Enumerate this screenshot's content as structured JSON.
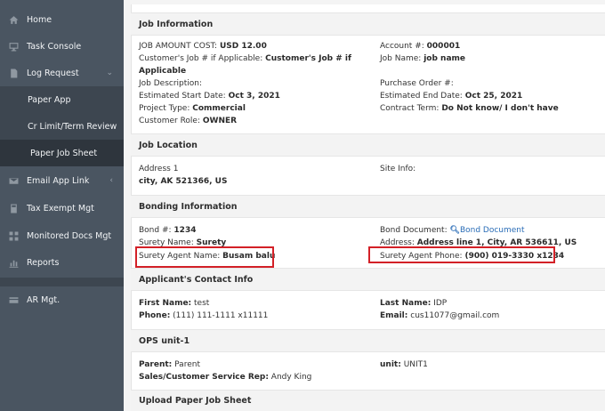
{
  "sidebar": {
    "items": [
      {
        "label": "Home",
        "icon": "home-icon"
      },
      {
        "label": "Task Console",
        "icon": "monitor-icon"
      },
      {
        "label": "Log Request",
        "icon": "file-icon",
        "arrow": "⌄"
      },
      {
        "label": "Paper App"
      },
      {
        "label": "Cr Limit/Term Review"
      },
      {
        "label": "Paper Job Sheet"
      },
      {
        "label": "Email App Link",
        "icon": "envelope-icon",
        "arrow": "‹"
      },
      {
        "label": "Tax Exempt Mgt",
        "icon": "calculator-icon"
      },
      {
        "label": "Monitored Docs Mgt",
        "icon": "grid-icon"
      },
      {
        "label": "Reports",
        "icon": "chart-icon"
      },
      {
        "label": "AR Mgt.",
        "icon": "card-icon"
      }
    ]
  },
  "job_info": {
    "title": "Job Information",
    "amount_label": "JOB AMOUNT COST:",
    "amount_value": "USD 12.00",
    "account_label": "Account #:",
    "account_value": "000001",
    "customer_job_label": "Customer's Job # if Applicable:",
    "customer_job_value_1": "Customer's Job # if",
    "customer_job_value_2": "Applicable",
    "job_name_label": "Job Name:",
    "job_name_value": "job name",
    "description_label": "Job Description:",
    "po_label": "Purchase Order #:",
    "start_label": "Estimated Start Date:",
    "start_value": "Oct 3, 2021",
    "end_label": "Estimated End Date:",
    "end_value": "Oct 25, 2021",
    "project_type_label": "Project Type:",
    "project_type_value": "Commercial",
    "contract_label": "Contract Term:",
    "contract_value": "Do Not know/ I don't have",
    "role_label": "Customer Role:",
    "role_value": "OWNER"
  },
  "job_location": {
    "title": "Job Location",
    "address_line1": "Address 1",
    "address_line2": "city,  AK 521366,  US",
    "site_info_label": "Site Info:"
  },
  "bonding": {
    "title": "Bonding Information",
    "bond_label": "Bond #:",
    "bond_value": "1234",
    "bond_doc_label": "Bond Document:",
    "bond_doc_link": "Bond Document",
    "surety_name_label": "Surety Name:",
    "surety_name_value": "Surety",
    "address_label": "Address:",
    "address_value": "Address line 1, City, AR 536611, US",
    "agent_name_label": "Surety Agent Name:",
    "agent_name_value": "Busam balu",
    "agent_phone_label": "Surety Agent Phone:",
    "agent_phone_value": "(900) 019-3330 x1234"
  },
  "contact": {
    "title": "Applicant's Contact Info",
    "first_label": "First Name:",
    "first_value": "test",
    "last_label": "Last Name:",
    "last_value": "IDP",
    "phone_label": "Phone:",
    "phone_value": "(111) 111-1111 x11111",
    "email_label": "Email:",
    "email_value": "cus11077@gmail.com"
  },
  "ops": {
    "title": "OPS unit-1",
    "parent_label": "Parent:",
    "parent_value": "Parent",
    "unit_label": "unit:",
    "unit_value": "UNIT1",
    "rep_label": "Sales/Customer Service Rep:",
    "rep_value": "Andy King"
  },
  "upload": {
    "title": "Upload Paper Job Sheet"
  },
  "colors": {
    "sidebar_bg": "#4a5561",
    "active_bg": "#2e353d",
    "highlight_border": "#d32027",
    "link": "#2a6db7"
  }
}
